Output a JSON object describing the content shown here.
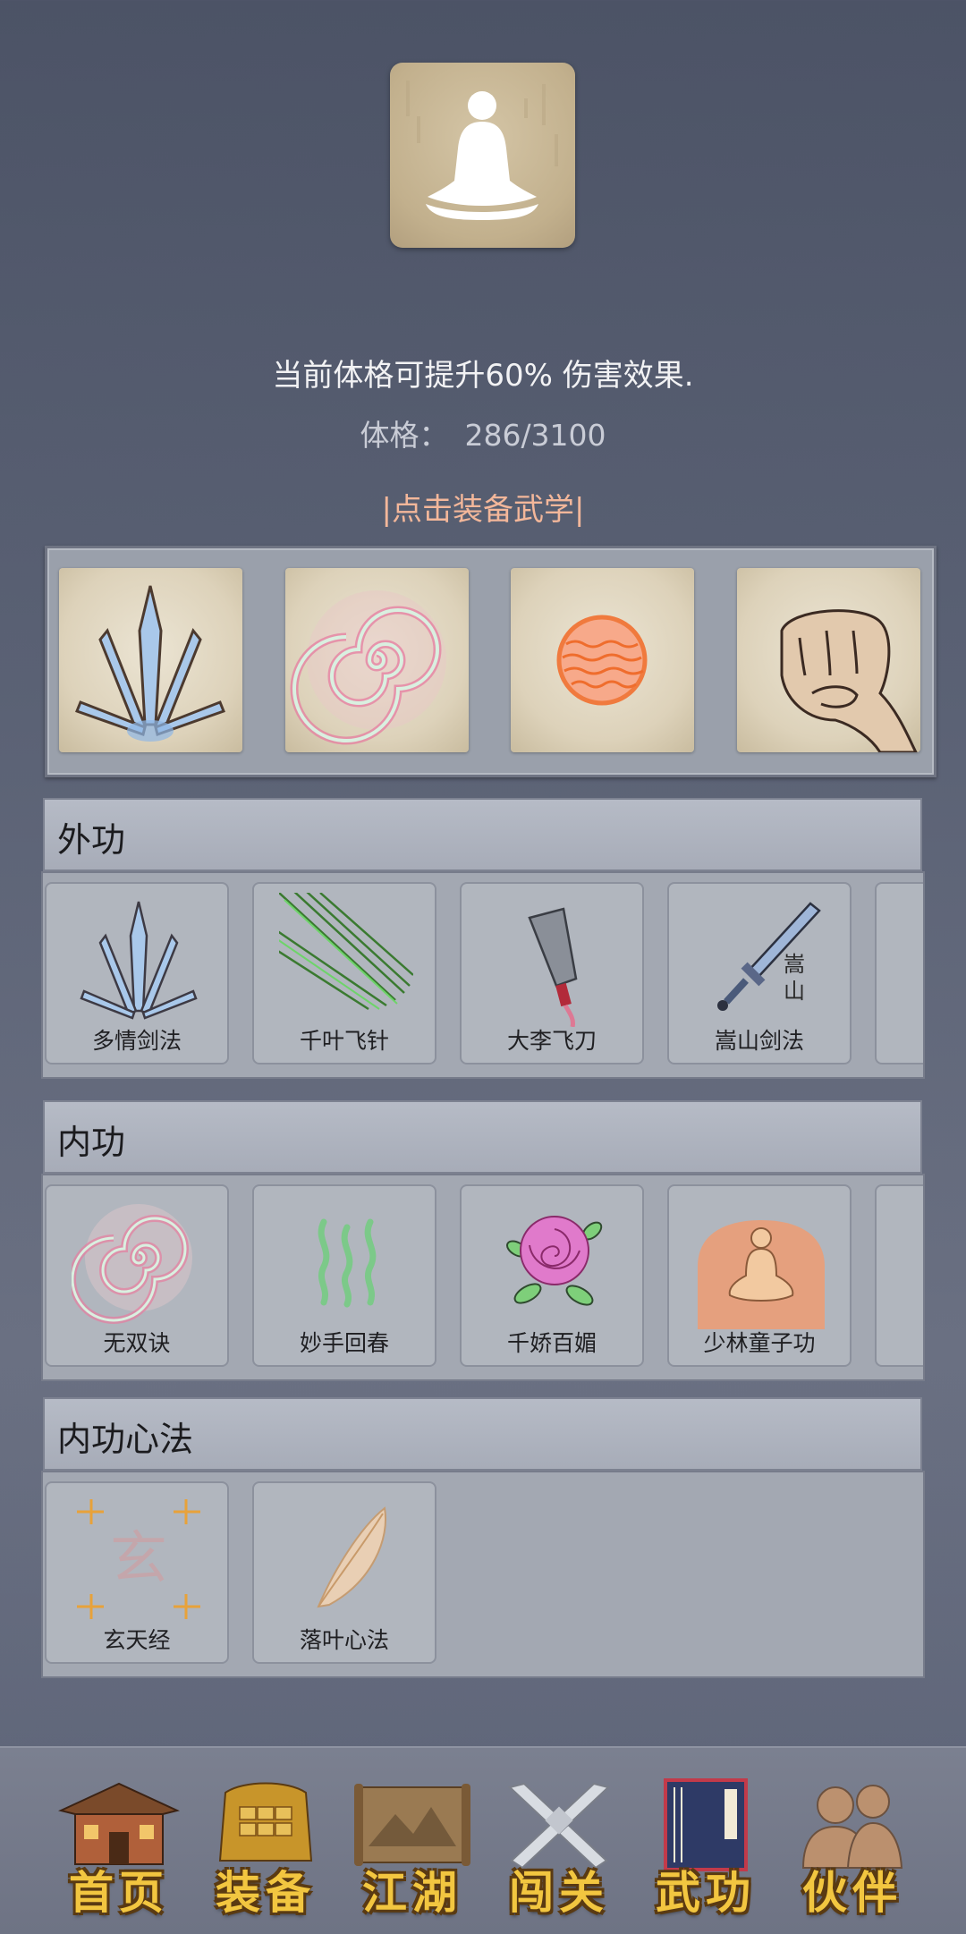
{
  "status": {
    "description": "当前体格可提升60% 伤害效果.",
    "stat_label": "体格：",
    "stat_value": "286/3100",
    "equip_hint": "|点击装备武学|"
  },
  "equipped": {
    "slots": [
      {
        "icon": "crystal-blades-icon"
      },
      {
        "icon": "swirl-icon"
      },
      {
        "icon": "fire-orb-icon"
      },
      {
        "icon": "fist-icon"
      }
    ]
  },
  "sections": {
    "external": {
      "title": "外功",
      "items": [
        {
          "name": "多情剑法",
          "icon": "crystal-blades-icon"
        },
        {
          "name": "千叶飞针",
          "icon": "needles-icon"
        },
        {
          "name": "大李飞刀",
          "icon": "cleaver-icon"
        },
        {
          "name": "嵩山剑法",
          "icon": "sword-icon",
          "icon_text": "嵩山"
        }
      ]
    },
    "internal": {
      "title": "内功",
      "items": [
        {
          "name": "无双诀",
          "icon": "swirl-icon"
        },
        {
          "name": "妙手回春",
          "icon": "green-waves-icon"
        },
        {
          "name": "千娇百媚",
          "icon": "rose-icon"
        },
        {
          "name": "少林童子功",
          "icon": "meditating-monk-icon"
        }
      ]
    },
    "mind": {
      "title": "内功心法",
      "items": [
        {
          "name": "玄天经",
          "icon": "xuan-rune-icon",
          "icon_text": "玄"
        },
        {
          "name": "落叶心法",
          "icon": "leaf-icon"
        }
      ]
    }
  },
  "nav": {
    "items": [
      {
        "label": "首页",
        "icon": "temple-icon"
      },
      {
        "label": "装备",
        "icon": "armor-icon"
      },
      {
        "label": "江湖",
        "icon": "scroll-map-icon"
      },
      {
        "label": "闯关",
        "icon": "crossed-swords-icon"
      },
      {
        "label": "武功",
        "icon": "martial-book-icon"
      },
      {
        "label": "伙伴",
        "icon": "companions-icon"
      }
    ]
  },
  "colors": {
    "background": "#5a6174",
    "accent_text": "#f3b79a",
    "nav_label": "#f2c640"
  }
}
